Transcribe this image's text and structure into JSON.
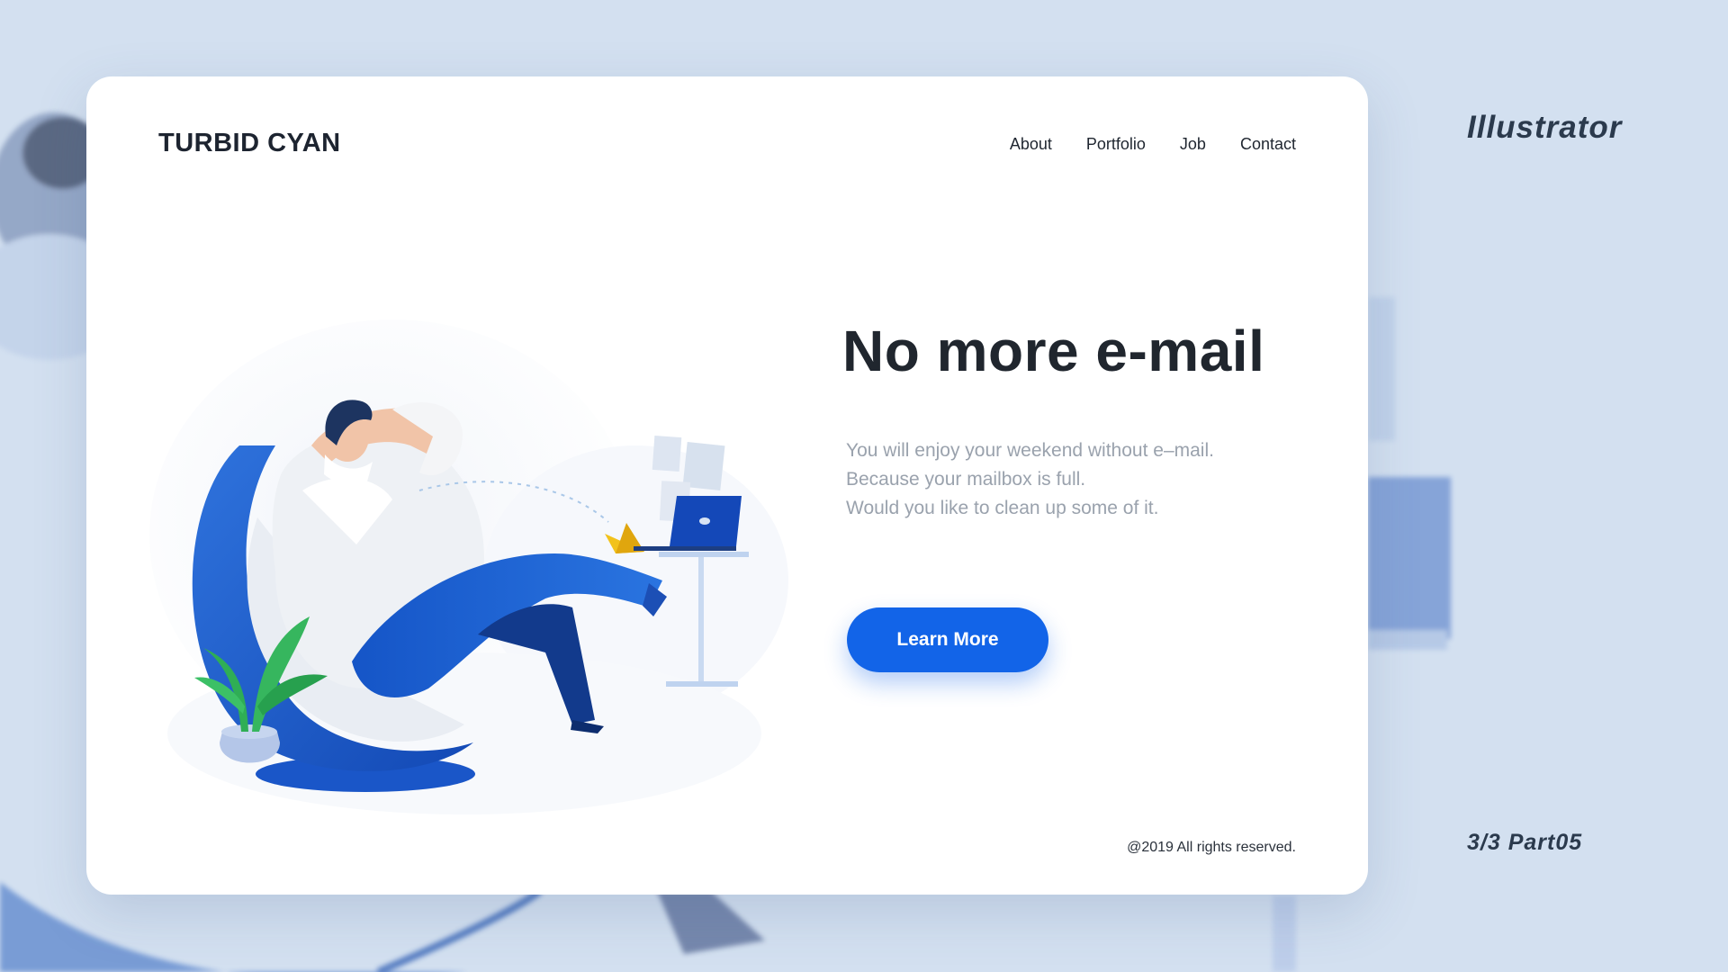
{
  "side": {
    "title": "Illustrator",
    "page": "3/3  Part05"
  },
  "header": {
    "logo": "TURBID CYAN",
    "nav": [
      "About",
      "Portfolio",
      "Job",
      "Contact"
    ]
  },
  "hero": {
    "headline": "No more e-mail",
    "body_lines": [
      "You will enjoy your weekend without e–mail.",
      "Because your mailbox is full.",
      "Would you like to clean up some of it."
    ],
    "cta_label": "Learn More"
  },
  "footer": {
    "copyright": "@2019 All rights reserved."
  },
  "colors": {
    "page_background": "#d3e0f0",
    "card_background": "#ffffff",
    "accent_blue": "#1264e8",
    "headline_text": "#20262e",
    "body_text": "#9aa2ad",
    "leaf_green": "#2fae55",
    "paper_plane_yellow": "#f2c21b"
  },
  "icons": {
    "paper_plane": "paper-plane-icon",
    "laptop": "laptop-icon"
  }
}
